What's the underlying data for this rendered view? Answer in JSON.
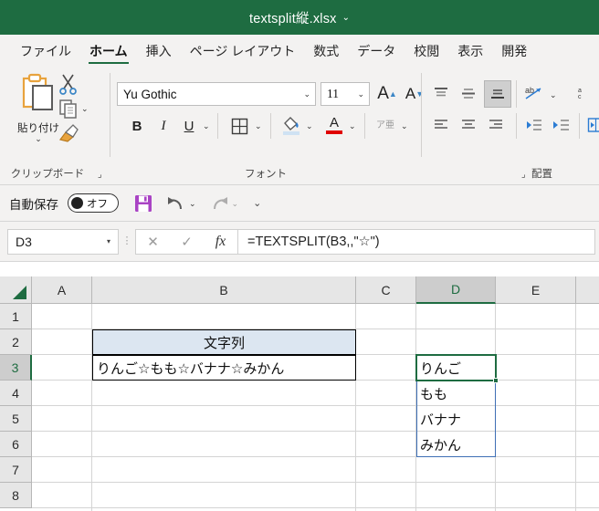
{
  "titlebar": {
    "filename": "textsplit縦.xlsx",
    "chevron": "⌄",
    "bg": "#1e6c41"
  },
  "tabs": [
    {
      "label": "ファイル",
      "active": false
    },
    {
      "label": "ホーム",
      "active": true
    },
    {
      "label": "挿入",
      "active": false
    },
    {
      "label": "ページ レイアウト",
      "active": false
    },
    {
      "label": "数式",
      "active": false
    },
    {
      "label": "データ",
      "active": false
    },
    {
      "label": "校閲",
      "active": false
    },
    {
      "label": "表示",
      "active": false
    },
    {
      "label": "開発",
      "active": false
    }
  ],
  "ribbon": {
    "clipboard": {
      "group_label": "クリップボード",
      "paste_label": "貼り付け",
      "paste_chevron": "⌄",
      "cut_name": "切り取り",
      "copy_name": "コピー",
      "copy_chevron": "⌄",
      "format_painter_name": "書式のコピー/貼り付け",
      "launcher": "⌟"
    },
    "font": {
      "group_label": "フォント",
      "font_name": "Yu Gothic",
      "font_size": "11",
      "grow_font": "A",
      "shrink_font": "A",
      "bold": "B",
      "italic": "I",
      "underline": "U",
      "borders_name": "罫線",
      "fill_color_name": "塗りつぶしの色",
      "font_color": "A",
      "phonetic": "ア亜",
      "chevron": "⌄",
      "launcher": "⌟"
    },
    "alignment": {
      "group_label": "配置",
      "align_top_name": "上揃え",
      "align_middle_name": "中央揃え(上下)",
      "align_bottom_name": "下揃え",
      "wrap_text_name": "折り返して全体を表示する",
      "align_left_name": "左揃え",
      "align_center_name": "中央揃え",
      "align_right_name": "右揃え",
      "decrease_indent_name": "インデントを減らす",
      "increase_indent_name": "インデントを増やす",
      "merge_name": "セルを結合して中央揃え",
      "orientation_name": "方向",
      "chevron": "⌄"
    }
  },
  "qat": {
    "autosave_label": "自動保存",
    "autosave_state": "オフ",
    "save_name": "上書き保存",
    "undo_name": "元に戻す",
    "undo_chevron": "⌄",
    "redo_name": "やり直し",
    "redo_chevron": "⌄",
    "customize_chevron": "⌄"
  },
  "formula_bar": {
    "name_box": "D3",
    "name_box_arrow": "▾",
    "cancel": "✕",
    "enter": "✓",
    "fx": "fx",
    "formula": "=TEXTSPLIT(B3,,\"☆\")"
  },
  "grid": {
    "columns": [
      {
        "label": "A",
        "selected": false
      },
      {
        "label": "B",
        "selected": false
      },
      {
        "label": "C",
        "selected": false
      },
      {
        "label": "D",
        "selected": true
      },
      {
        "label": "E",
        "selected": false
      }
    ],
    "rows": [
      {
        "label": "1",
        "selected": false
      },
      {
        "label": "2",
        "selected": false
      },
      {
        "label": "3",
        "selected": true
      },
      {
        "label": "4",
        "selected": false
      },
      {
        "label": "5",
        "selected": false
      },
      {
        "label": "6",
        "selected": false
      },
      {
        "label": "7",
        "selected": false
      },
      {
        "label": "8",
        "selected": false
      }
    ],
    "cells": {
      "b2": "文字列",
      "b3": "りんご☆もも☆バナナ☆みかん",
      "d3": "りんご",
      "d4": "もも",
      "d5": "バナナ",
      "d6": "みかん"
    },
    "active_cell": "D3",
    "spill_range": "D3:D6",
    "header_fill": "#dce6f1",
    "active_border": "#1e6c41",
    "spill_border": "#3f6fb5"
  }
}
